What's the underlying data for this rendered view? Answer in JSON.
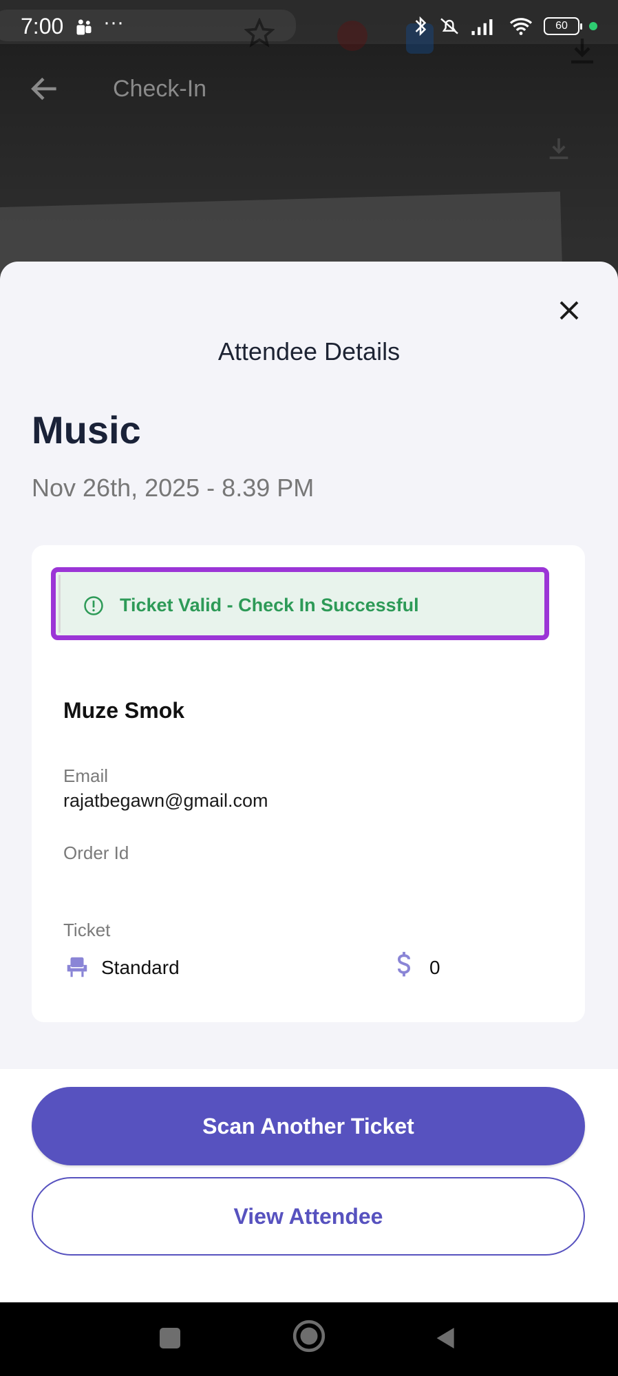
{
  "status_bar": {
    "time": "7:00",
    "battery": "60",
    "icons": [
      "teams-icon",
      "more-icon",
      "bluetooth-icon",
      "mute-icon",
      "signal-icon",
      "wifi-icon",
      "battery-icon",
      "privacy-dot-icon"
    ]
  },
  "header": {
    "title": "Check-In",
    "back_icon": "arrow-left-icon"
  },
  "sheet": {
    "title": "Attendee Details",
    "close_icon": "close-icon",
    "event_name": "Music",
    "event_date": "Nov 26th, 2025 - 8.39 PM",
    "status_message": "Ticket Valid - Check In Successful",
    "status_color": "#2d9a57",
    "highlight_color": "#9b35d6",
    "attendee_name": "Muze Smok",
    "email_label": "Email",
    "email_value": "rajatbegawn@gmail.com",
    "order_label": "Order Id",
    "order_value": "",
    "ticket_label": "Ticket",
    "ticket_type": "Standard",
    "ticket_price": "0"
  },
  "actions": {
    "scan_label": "Scan Another Ticket",
    "view_label": "View Attendee",
    "accent_color": "#5752bf"
  },
  "nav": {
    "recents_icon": "square-icon",
    "home_icon": "circle-home-icon",
    "back_icon": "triangle-back-icon"
  }
}
